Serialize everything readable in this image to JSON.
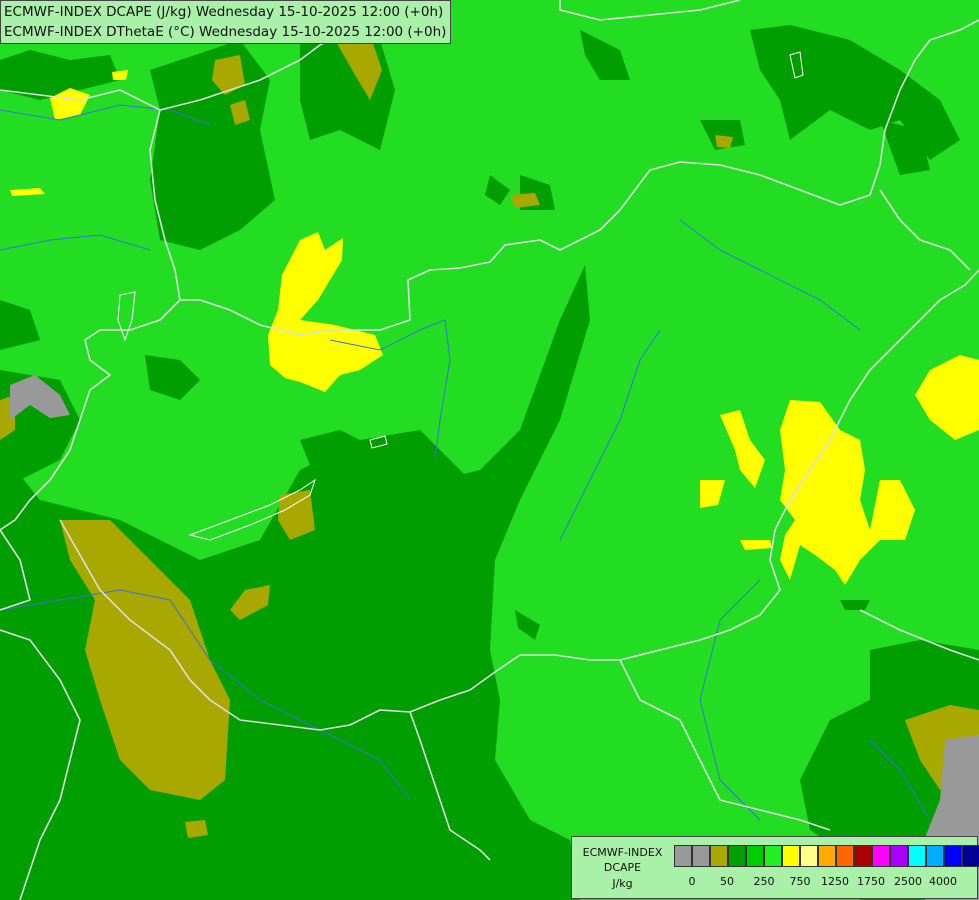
{
  "header": {
    "line1": "ECMWF-INDEX DCAPE (J/kg) Wednesday 15-10-2025 12:00 (+0h)",
    "line2": "ECMWF-INDEX DThetaE (°C) Wednesday 15-10-2025 12:00 (+0h)"
  },
  "legend": {
    "model": "ECMWF-INDEX",
    "variable": "DCAPE",
    "unit": "J/kg",
    "colors": [
      "#999999",
      "#999999",
      "#a8a800",
      "#00a000",
      "#00cc00",
      "#22ee22",
      "#ffff00",
      "#ffff88",
      "#ffaa00",
      "#ff6600",
      "#aa0000",
      "#ff00ff",
      "#aa00ff",
      "#00ffff",
      "#00aaff",
      "#0000ff",
      "#000099"
    ],
    "ticks": [
      "0",
      "50",
      "250",
      "750",
      "1250",
      "1750",
      "2500",
      "4000"
    ]
  },
  "map": {
    "colors": {
      "light_green": "#22dd22",
      "dark_green": "#009e00",
      "olive": "#a8a800",
      "yellow": "#ffff00",
      "gray": "#999999",
      "border": "#dddddd",
      "river": "#3a6fd8"
    }
  }
}
